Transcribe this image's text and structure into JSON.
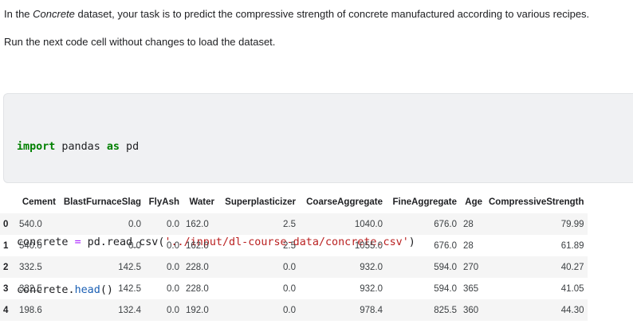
{
  "markdown": {
    "intro_before": "In the ",
    "intro_dataset": "Concrete",
    "intro_after": " dataset, your task is to predict the compressive strength of concrete manufactured according to various recipes.",
    "run_note": "Run the next code cell without changes to load the dataset."
  },
  "code": {
    "l1_kw1": "import",
    "l1_mod": " pandas ",
    "l1_kw2": "as",
    "l1_alias": " pd",
    "l2_var": "concrete ",
    "l2_op": "=",
    "l2_call": " pd.read_csv(",
    "l2_str": "'../input/dl-course-data/concrete.csv'",
    "l2_close": ")",
    "l3_var": "concrete.",
    "l3_attr": "head",
    "l3_paren": "()"
  },
  "dataframe": {
    "columns": [
      "Cement",
      "BlastFurnaceSlag",
      "FlyAsh",
      "Water",
      "Superplasticizer",
      "CoarseAggregate",
      "FineAggregate",
      "Age",
      "CompressiveStrength"
    ],
    "rows": [
      {
        "index": "0",
        "cells": [
          "540.0",
          "0.0",
          "0.0",
          "162.0",
          "2.5",
          "1040.0",
          "676.0",
          "28",
          "79.99"
        ]
      },
      {
        "index": "1",
        "cells": [
          "540.0",
          "0.0",
          "0.0",
          "162.0",
          "2.5",
          "1055.0",
          "676.0",
          "28",
          "61.89"
        ]
      },
      {
        "index": "2",
        "cells": [
          "332.5",
          "142.5",
          "0.0",
          "228.0",
          "0.0",
          "932.0",
          "594.0",
          "270",
          "40.27"
        ]
      },
      {
        "index": "3",
        "cells": [
          "332.5",
          "142.5",
          "0.0",
          "228.0",
          "0.0",
          "932.0",
          "594.0",
          "365",
          "41.05"
        ]
      },
      {
        "index": "4",
        "cells": [
          "198.6",
          "132.4",
          "0.0",
          "192.0",
          "0.0",
          "978.4",
          "825.5",
          "360",
          "44.30"
        ]
      }
    ]
  }
}
